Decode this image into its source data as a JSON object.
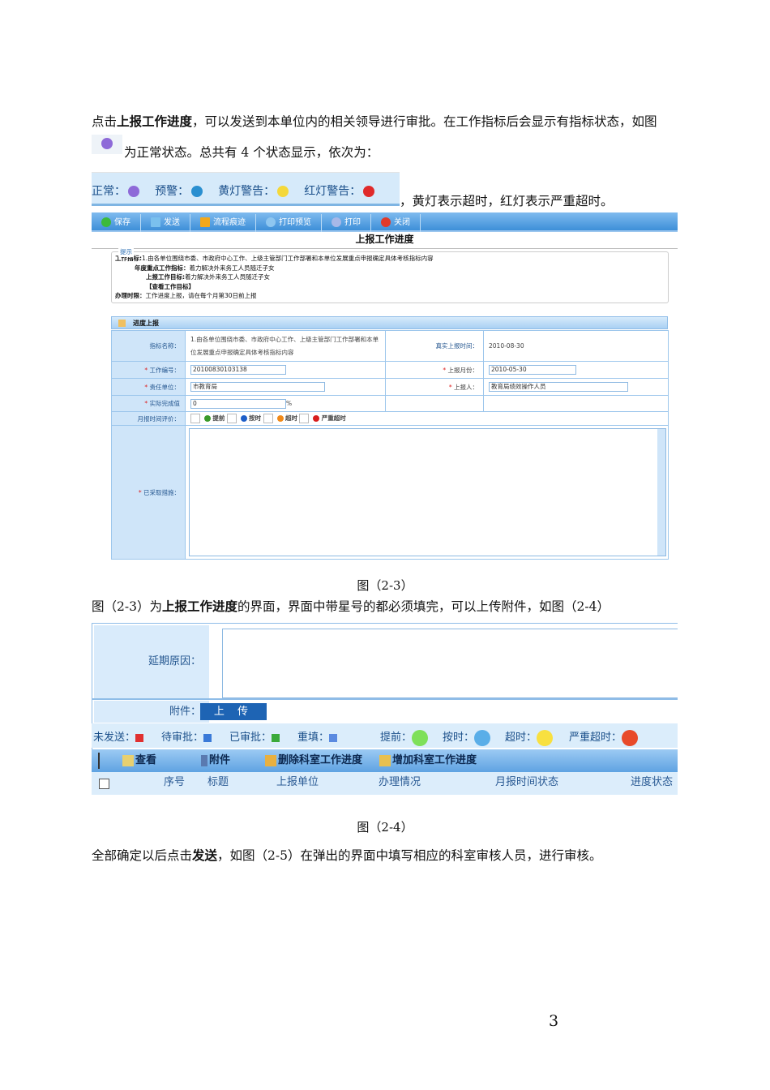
{
  "para1": {
    "pre": "点击",
    "bold": "上报工作进度",
    "post": "，可以发送到本单位内的相关领导进行审批。在工作指标后会显示有指标状态，如图",
    "line2": "为正常状态。总共有 4 个状态显示，依次为："
  },
  "status_legend": [
    {
      "label": "正常：",
      "icon": "gear-icon",
      "color": "#8e6ad8"
    },
    {
      "label": "预警：",
      "icon": "rss-icon",
      "color": "#2a8fd0"
    },
    {
      "label": "黄灯警告：",
      "icon": "yellow-bulb-icon",
      "color": "#f4d83a"
    },
    {
      "label": "红灯警告：",
      "icon": "red-bulb-icon",
      "color": "#e02a2a"
    }
  ],
  "status_tail": "，黄灯表示超时，红灯表示严重超时。",
  "fig1": {
    "toolbar": [
      {
        "label": "保存",
        "color": "#3cba3c"
      },
      {
        "label": "发送",
        "color": "#7ac0ee"
      },
      {
        "label": "流程痕迹",
        "color": "#f2a81c"
      },
      {
        "label": "打印预览",
        "color": "#8ec6f0"
      },
      {
        "label": "打印",
        "color": "#a8b8e8"
      },
      {
        "label": "关闭",
        "color": "#e03a2a"
      }
    ],
    "title": "上报工作进度",
    "hint": {
      "legend": "提示",
      "l1k": "工作指标:",
      "l1v": "1.由各单位围绕市委、市政府中心工作、上级主管部门工作部署和本单位发展重点申报确定具体考核指标内容",
      "l2k": "年度重点工作指标：",
      "l2v": "着力解决外来务工人员随迁子女",
      "l3k": "上报工作目标:",
      "l3v": "着力解决外来务工人员随迁子女",
      "l4": "【查看工作目标】",
      "l5k": "办理时限：",
      "l5v": "工作进度上报，请在每个月第30日前上报"
    },
    "section": "进度上报",
    "f": {
      "name_l": "指标名称：",
      "name_v": "1.由各单位围绕市委、市政府中心工作、上级主管部门工作部署和本单位发展重点申报确定具体考核指标内容",
      "real_l": "真实上报时间：",
      "real_v": "2010-08-30",
      "no_l": "工作编号：",
      "no_v": "20100830103138",
      "month_l": "上报月份：",
      "month_v": "2010-05-30",
      "unit_l": "责任单位：",
      "unit_v": "市教育局",
      "rep_l": "上报人：",
      "rep_v": "教育局绩效操作人员",
      "val_l": "实际完成值",
      "val_v": "0",
      "pct": "%",
      "eval_l": "月报时间评价：",
      "evals": [
        {
          "label": "提前",
          "color": "#3a9a2a"
        },
        {
          "label": "按时",
          "color": "#1e5fc8"
        },
        {
          "label": "超时",
          "color": "#f08a1a"
        },
        {
          "label": "严重超时",
          "color": "#d81e1e"
        }
      ],
      "meas_l": "已采取措施："
    },
    "star": "*"
  },
  "cap1": "图（2-3）",
  "para2": {
    "pre": "图（2-3）为",
    "bold": "上报工作进度",
    "post": "的界面，界面中带星号的都必须填完，可以上传附件，如图（2-4）"
  },
  "fig2": {
    "delay_l": "延期原因：",
    "att_l": "附件：",
    "upload": "上 传",
    "legend": [
      {
        "label": "未发送：",
        "color": "#e03030"
      },
      {
        "label": "待审批：",
        "color": "#3a7ad8"
      },
      {
        "label": "已审批：",
        "color": "#3aaa3a"
      },
      {
        "label": "重填：",
        "color": "#5a8ae0"
      }
    ],
    "lights": [
      {
        "label": "提前：",
        "color": "#7ee05a"
      },
      {
        "label": "按时：",
        "color": "#5aaee8"
      },
      {
        "label": "超时：",
        "color": "#f8e040"
      },
      {
        "label": "严重超时：",
        "color": "#e84a2a"
      }
    ],
    "toolbar": [
      "查看",
      "附件",
      "删除科室工作进度",
      "增加科室工作进度"
    ],
    "headers": [
      "序号",
      "标题",
      "上报单位",
      "办理情况",
      "月报时间状态",
      "进度状态"
    ]
  },
  "cap2": "图（2-4）",
  "para3": {
    "pre": "全部确定以后点击",
    "bold": "发送",
    "post": "，如图（2-5）在弹出的界面中填写相应的科室审核人员，进行审核。"
  },
  "page_number": "3"
}
